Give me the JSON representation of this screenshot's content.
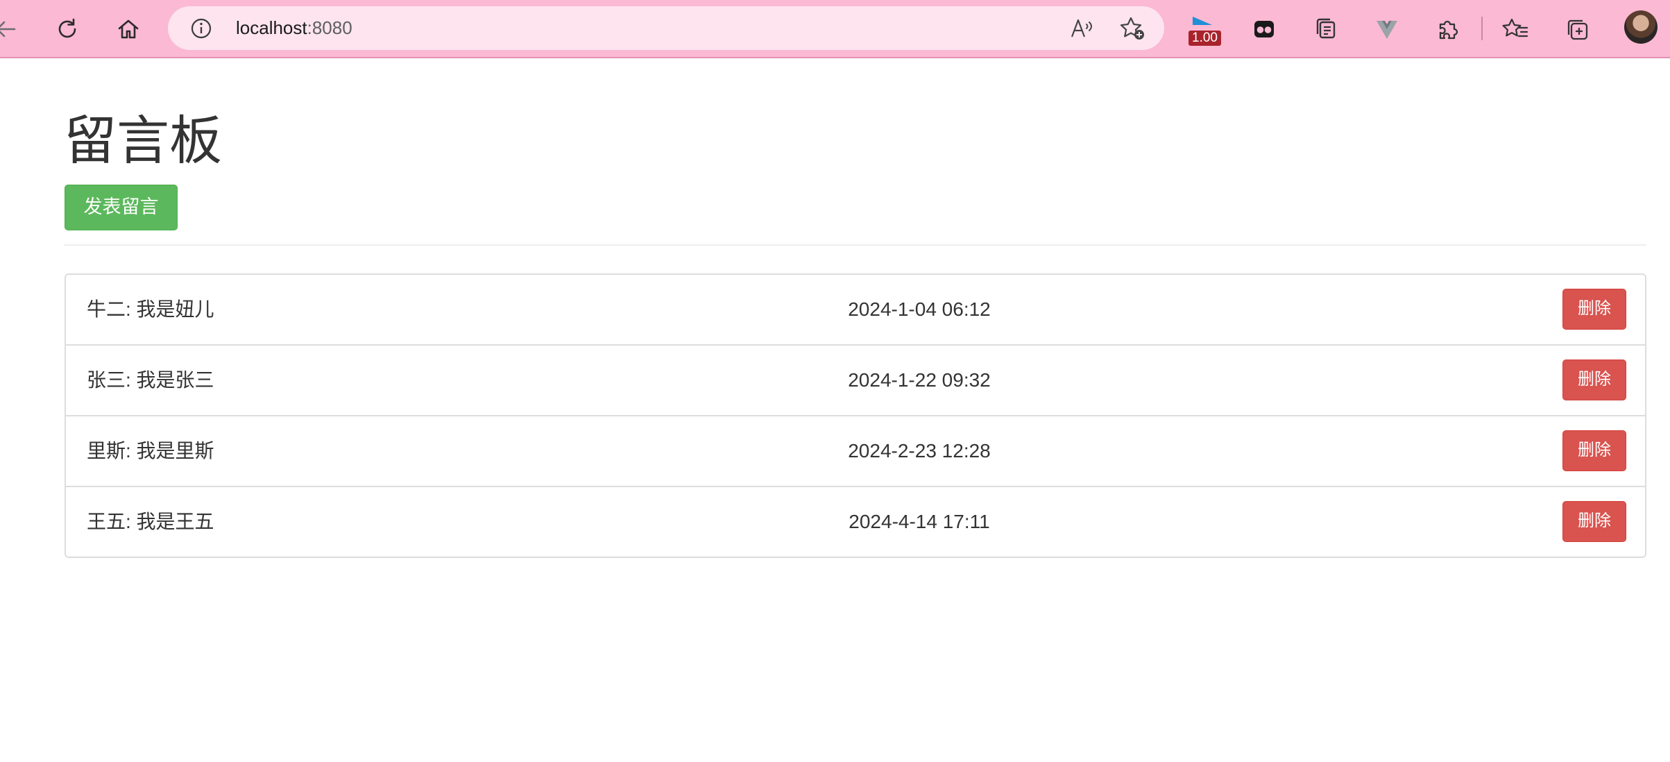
{
  "browser": {
    "url_host": "localhost",
    "url_port": ":8080",
    "extension_badge": "1.00",
    "icons": [
      "back-arrow-icon",
      "refresh-icon",
      "home-icon",
      "info-icon",
      "read-aloud-icon",
      "add-favorite-icon",
      "extension-player-icon",
      "extension-mask-icon",
      "collections-icon",
      "vue-devtools-icon",
      "extensions-puzzle-icon",
      "favorites-icon",
      "add-tab-icon",
      "profile-avatar"
    ]
  },
  "page": {
    "title": "留言板",
    "post_button": "发表留言"
  },
  "messages": [
    {
      "text": "牛二: 我是妞儿",
      "time": "2024-1-04 06:12",
      "delete_label": "删除"
    },
    {
      "text": "张三: 我是张三",
      "time": "2024-1-22 09:32",
      "delete_label": "删除"
    },
    {
      "text": "里斯: 我是里斯",
      "time": "2024-2-23 12:28",
      "delete_label": "删除"
    },
    {
      "text": "王五: 我是王五",
      "time": "2024-4-14 17:11",
      "delete_label": "删除"
    }
  ],
  "colors": {
    "toolbar_bg": "#fbb9d3",
    "address_bg": "#fde4ee",
    "post_button": "#5cb85c",
    "delete_button": "#d9534f"
  }
}
